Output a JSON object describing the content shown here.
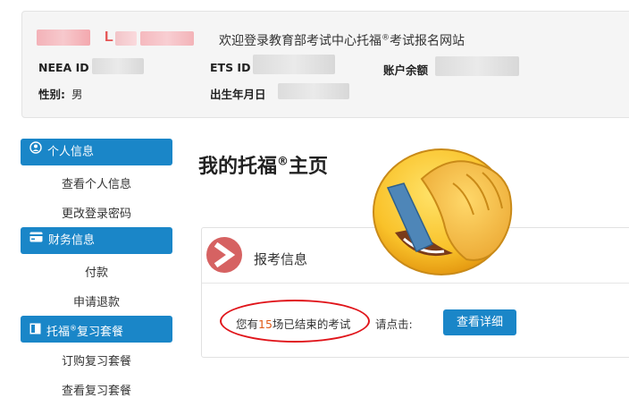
{
  "header": {
    "name_visible_letter": "L",
    "welcome_prefix": "欢迎登录教育部考试中心托福",
    "welcome_reg": "®",
    "welcome_suffix": "考试报名网站",
    "neea_id_label": "NEEA ID",
    "ets_id_label": "ETS ID",
    "balance_label": "账户余额",
    "gender_label": "性别:",
    "gender_value": "男",
    "birthdate_label": "出生年月日"
  },
  "sidebar": {
    "sections": [
      {
        "title": "个人信息",
        "icon": "user-circle-icon",
        "items": [
          "查看个人信息",
          "更改登录密码"
        ]
      },
      {
        "title": "财务信息",
        "icon": "credit-card-icon",
        "items": [
          "付款",
          "申请退款"
        ]
      },
      {
        "title_prefix": "托福",
        "title_reg": "®",
        "title_suffix": "复习套餐",
        "icon": "book-icon",
        "items": [
          "订购复习套餐",
          "查看复习套餐"
        ]
      }
    ]
  },
  "main": {
    "title_prefix": "我的托福",
    "title_reg": "®",
    "title_suffix": "主页",
    "card": {
      "title": "报考信息",
      "icon": "arrow-right-circle-icon",
      "exam_prefix": "您有",
      "exam_count": "15",
      "exam_suffix": "场已结束的考试",
      "click_label": "请点击:",
      "detail_button": "查看详细"
    }
  },
  "colors": {
    "primary_blue": "#1a86c8",
    "card_icon_red": "#d66262",
    "annotation_red": "#e0141a",
    "count_orange": "#e05a17"
  }
}
